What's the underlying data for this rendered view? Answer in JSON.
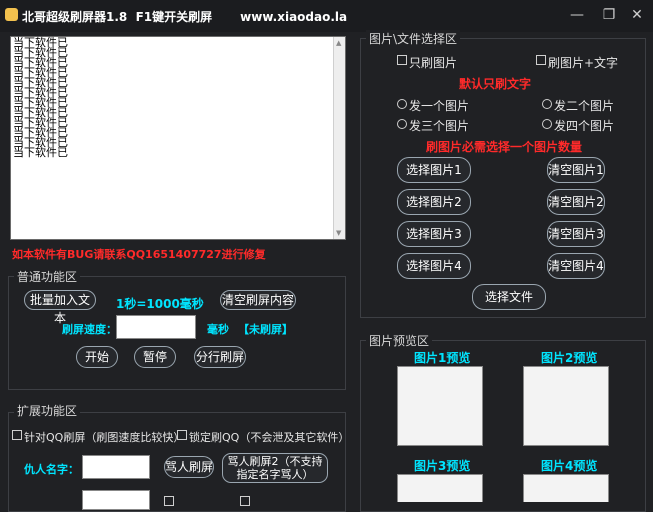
{
  "window": {
    "title": "北哥超级刷屏器1.8  F1键开关刷屏",
    "url": "www.xiaodao.la",
    "minimize": "—",
    "restore": "❐",
    "close": "✕"
  },
  "log": {
    "lines": [
      "当下软件已",
      "当下软件已",
      "当下软件已",
      "当下软件已",
      "当下软件已",
      "当下软件已",
      "当下软件已",
      "当下软件已",
      "当下软件已",
      "当下软件已",
      "当下软件已",
      "当下软件已"
    ]
  },
  "notice": "如本软件有BUG请联系QQ1651407727进行修复",
  "general": {
    "title": "普通功能区",
    "batch_add": "批量加入文本",
    "second_info": "1秒=1000毫秒",
    "clear_content": "清空刷屏内容",
    "speed_label": "刷屏速度：",
    "speed_value": "",
    "ms_label": "毫秒",
    "status": "【未刷屏】",
    "start": "开始",
    "pause": "暂停",
    "line_flood": "分行刷屏"
  },
  "extended": {
    "title": "扩展功能区",
    "qq_flood": "针对QQ刷屏（刷图速度比较快）",
    "lock_qq": "锁定刷QQ（不会泄及其它软件）",
    "enemy_label": "仇人名字：",
    "enemy_value": "",
    "curse": "骂人刷屏",
    "curse2_line1": "骂人刷屏2（不支持",
    "curse2_line2": "指定名字骂人）"
  },
  "image_select": {
    "title": "图片\\文件选择区",
    "only_image": "只刷图片",
    "image_text": "刷图片+文字",
    "default_text": "默认只刷文字",
    "send1": "发一个图片",
    "send2": "发二个图片",
    "send3": "发三个图片",
    "send4": "发四个图片",
    "must_select": "刷图片必需选择一个图片数量",
    "select1": "选择图片1",
    "select2": "选择图片2",
    "select3": "选择图片3",
    "select4": "选择图片4",
    "clear1": "清空图片1",
    "clear2": "清空图片2",
    "clear3": "清空图片3",
    "clear4": "清空图片4",
    "select_file": "选择文件"
  },
  "preview": {
    "title": "图片预览区",
    "p1": "图片1预览",
    "p2": "图片2预览",
    "p3": "图片3预览",
    "p4": "图片4预览"
  },
  "colors": {
    "background": "#202124",
    "accent_red": "#ff2a2a",
    "accent_cyan": "#00e5ff"
  }
}
